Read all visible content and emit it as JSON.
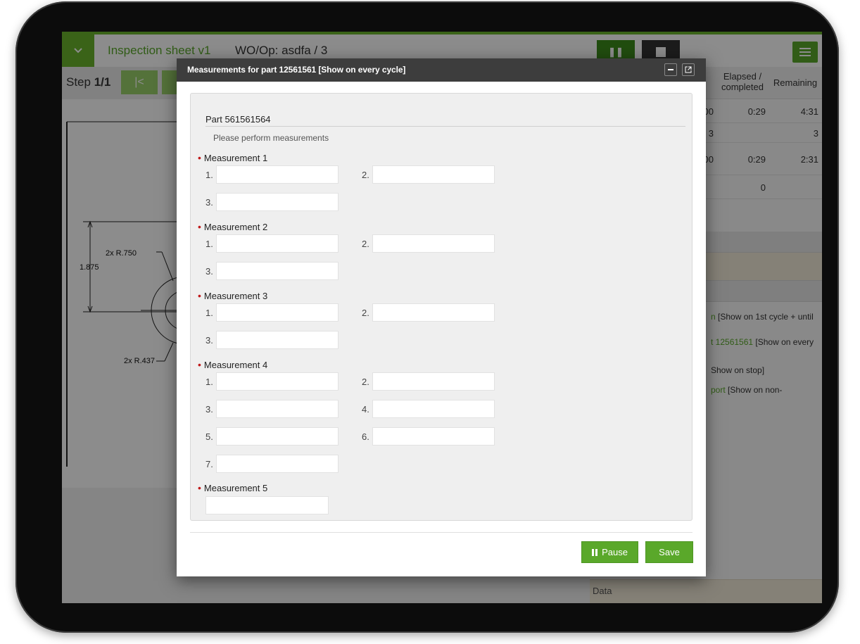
{
  "app": {
    "sheet_title": "Inspection sheet v1",
    "wo_title": "WO/Op: asdfa / 3",
    "step_prefix": "Step",
    "step_value": "1/1",
    "pause_icon": "pause-icon",
    "stop_icon": "stop-icon",
    "menu_icon": "hamburger-icon",
    "accent_color": "#5aa82a"
  },
  "drawing": {
    "dim_height": "1.875",
    "dim_r750": "2x R.750",
    "dim_r437": "2x R.437"
  },
  "right_panel": {
    "col_elapsed": "Elapsed / completed",
    "col_remaining": "Remaining",
    "rows": [
      {
        "a": "00",
        "elapsed": "0:29",
        "remaining": "4:31"
      },
      {
        "a": "3",
        "elapsed": "",
        "remaining": "3"
      },
      {
        "a": "00",
        "elapsed": "0:29",
        "remaining": "2:31"
      },
      {
        "a": "",
        "elapsed": "0",
        "remaining": ""
      }
    ],
    "links": [
      {
        "green": "n",
        "rest": " [Show on 1st cycle + until"
      },
      {
        "green": "t 12561561",
        "rest": " [Show on every"
      },
      {
        "green": "",
        "rest": "Show on stop]"
      },
      {
        "green": "port",
        "rest": " [Show on non-"
      }
    ],
    "data_label": "Data"
  },
  "modal": {
    "title": "Measurements for part 12561561",
    "title_tag": "[Show on every cycle]",
    "part_title": "Part 561561564",
    "help_text": "Please perform measurements",
    "required_marker": "•",
    "measurements": [
      {
        "label": "Measurement 1",
        "fields": [
          "1.",
          "2.",
          "3."
        ]
      },
      {
        "label": "Measurement 2",
        "fields": [
          "1.",
          "2.",
          "3."
        ]
      },
      {
        "label": "Measurement 3",
        "fields": [
          "1.",
          "2.",
          "3."
        ]
      },
      {
        "label": "Measurement 4",
        "fields": [
          "1.",
          "2.",
          "3.",
          "4.",
          "5.",
          "6.",
          "7."
        ]
      },
      {
        "label": "Measurement 5",
        "fields": []
      }
    ],
    "pause_label": "Pause",
    "save_label": "Save"
  }
}
